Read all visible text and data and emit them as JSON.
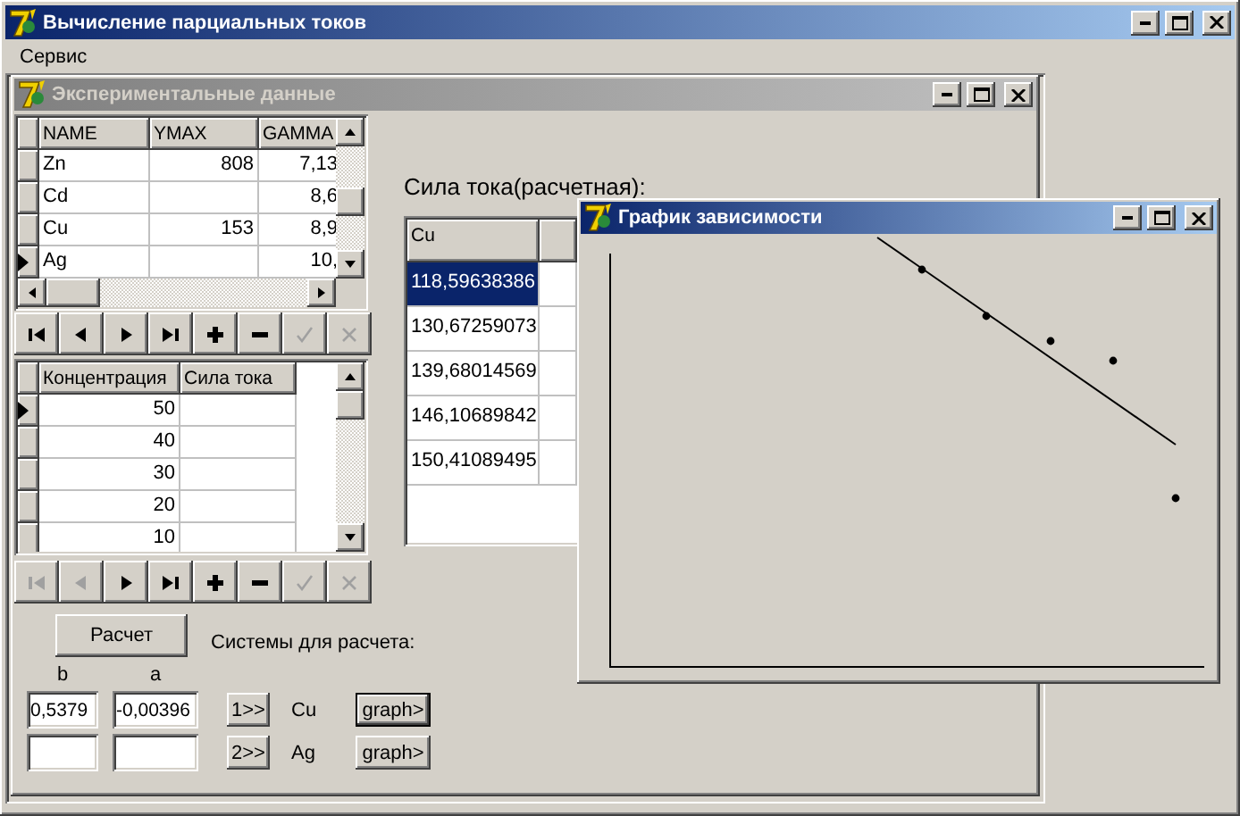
{
  "window": {
    "title": "Вычисление парциальных токов",
    "active": true
  },
  "menu": [
    {
      "label": "Сервис"
    }
  ],
  "data_window": {
    "title": "Экспериментальные данные",
    "active": false,
    "elements_grid": {
      "columns": [
        "NAME",
        "YMAX",
        "GAMMA"
      ],
      "rows": [
        {
          "name": "Zn",
          "ymax": "808",
          "gamma": "7,13",
          "selected": false
        },
        {
          "name": "Cd",
          "gamma": "8,6",
          "selected": false
        },
        {
          "name": "Cu",
          "ymax": "153",
          "gamma": "8,9",
          "selected": false
        },
        {
          "name": "Ag",
          "gamma": "10,",
          "selected": true
        }
      ]
    },
    "elements_nav": {
      "buttons": [
        {
          "kind": "first",
          "disabled": false
        },
        {
          "kind": "prior",
          "disabled": false
        },
        {
          "kind": "next",
          "disabled": false
        },
        {
          "kind": "last",
          "disabled": false
        },
        {
          "kind": "insert",
          "disabled": false
        },
        {
          "kind": "delete",
          "disabled": false
        },
        {
          "kind": "post",
          "disabled": true
        },
        {
          "kind": "cancel",
          "disabled": true
        }
      ]
    },
    "concentration_grid": {
      "columns": [
        "Концентрация",
        "Сила тока"
      ],
      "rows": [
        {
          "concentration": "50",
          "selected": true
        },
        {
          "concentration": "40",
          "selected": false
        },
        {
          "concentration": "30",
          "selected": false
        },
        {
          "concentration": "20",
          "selected": false
        },
        {
          "concentration": "10",
          "selected": false
        }
      ]
    },
    "concentration_nav": {
      "buttons": [
        {
          "kind": "first",
          "disabled": true
        },
        {
          "kind": "prior",
          "disabled": true
        },
        {
          "kind": "next",
          "disabled": false
        },
        {
          "kind": "last",
          "disabled": false
        },
        {
          "kind": "insert",
          "disabled": false
        },
        {
          "kind": "delete",
          "disabled": false
        },
        {
          "kind": "post",
          "disabled": true
        },
        {
          "kind": "cancel",
          "disabled": true
        }
      ]
    },
    "results_label": "Сила тока(расчетная):",
    "results_grid": {
      "columns": [
        "Cu"
      ],
      "rows": [
        {
          "value": "118,59638386",
          "selected": true
        },
        {
          "value": "130,67259073",
          "selected": false
        },
        {
          "value": "139,68014569",
          "selected": false
        },
        {
          "value": "146,10689842",
          "selected": false
        },
        {
          "value": "150,41089495",
          "selected": false
        }
      ]
    },
    "calc_button": "Расчет",
    "systems_label": "Системы для расчета:",
    "coef_headers": [
      "b",
      "a"
    ],
    "systems": [
      {
        "b": "0,5379",
        "a": "-0,00396",
        "button": "1>>",
        "name": "Cu",
        "graph_button": "graph>",
        "focused": true
      },
      {
        "button": "2>>",
        "name": "Ag",
        "graph_button": "graph>",
        "focused": false
      }
    ]
  },
  "graph_window": {
    "title": "График зависимости",
    "active": true
  }
}
